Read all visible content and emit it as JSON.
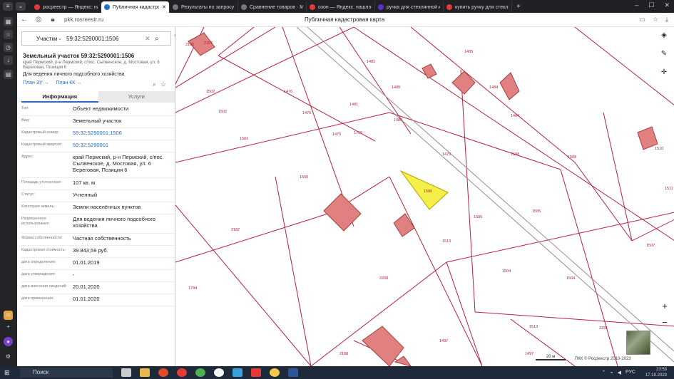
{
  "browser": {
    "tabs": [
      {
        "label": "росреестр — Яндекс: нашл",
        "active": false,
        "color": "#e53935"
      },
      {
        "label": "Публичная кадастровая",
        "active": true,
        "color": "#2a6cc8"
      },
      {
        "label": "Результаты по запросу «р",
        "active": false,
        "color": "#777777"
      },
      {
        "label": "Сравнение товаров · Мар",
        "active": false,
        "color": "#777777"
      },
      {
        "label": "озон — Яндекс: нашлось",
        "active": false,
        "color": "#e53935"
      },
      {
        "label": "ручка для стеклянной кр",
        "active": false,
        "color": "#5b2fd0"
      },
      {
        "label": "купить ручку для стеклян",
        "active": false,
        "color": "#e53935"
      }
    ],
    "new_tab": "+",
    "url": "pkk.rosreestr.ru",
    "page_title": "Публичная кадастровая карта"
  },
  "search": {
    "category": "Участки",
    "value": "59:32:5290001:1506"
  },
  "parcel": {
    "title": "Земельный участок 59:32:5290001:1506",
    "address_short": "край Пермский, р-н Пермский, с/пос. Сылвенское, д. Мостовая, ул. 6 Береговая, Позиция 6",
    "use": "Для ведения личного подсобного хозяйства",
    "plan_zu": "План ЗУ →",
    "plan_kk": "План КК →"
  },
  "tabs": {
    "info": "Информация",
    "services": "Услуги"
  },
  "properties": [
    {
      "label": "Тип:",
      "value": "Объект недвижимости",
      "link": false
    },
    {
      "label": "Вид:",
      "value": "Земельный участок",
      "link": false
    },
    {
      "label": "Кадастровый номер:",
      "value": "59:32:5290001:1506",
      "link": true
    },
    {
      "label": "Кадастровый квартал:",
      "value": "59:32:5290001",
      "link": true
    },
    {
      "label": "Адрес:",
      "value": "край Пермский, р-н Пермский, с/пос. Сылвенское, д. Мостовая, ул. 6 Береговая, Позиция 6",
      "link": false
    },
    {
      "label": "Площадь уточненная:",
      "value": "107 кв. м",
      "link": false
    },
    {
      "label": "Статус:",
      "value": "Учтенный",
      "link": false
    },
    {
      "label": "Категория земель:",
      "value": "Земли населённых пунктов",
      "link": false
    },
    {
      "label": "Разрешенное использование:",
      "value": "Для ведения личного подсобного хозяйства",
      "link": false
    },
    {
      "label": "Форма собственности:",
      "value": "Частная собственность",
      "link": false
    },
    {
      "label": "Кадастровая стоимость:",
      "value": "39 843,59 руб.",
      "link": false
    },
    {
      "label": "дата определения:",
      "value": "01.01.2019",
      "link": false
    },
    {
      "label": "дата утверждения:",
      "value": "-",
      "link": false
    },
    {
      "label": "дата внесения сведений:",
      "value": "20.01.2020",
      "link": false
    },
    {
      "label": "дата применения:",
      "value": "01.01.2020",
      "link": false
    }
  ],
  "map": {
    "labels": [
      "2196",
      "2197",
      "1485",
      "1481",
      "1480",
      "1484",
      "1502",
      "1476",
      "1481",
      "1502",
      "1476",
      "1480",
      "1484",
      "1501",
      "1475",
      "1750",
      "1479",
      "1508",
      "1508",
      "1510",
      "1500",
      "1506",
      "1505",
      "1505",
      "1512",
      "2187",
      "1513",
      "1507",
      "2208",
      "1504",
      "1504",
      "1794",
      "1513",
      "2231",
      "1497",
      "1497",
      "2188"
    ],
    "scale": "20 м",
    "copyright": "ПКК © Росреестр 2010-2023"
  },
  "taskbar": {
    "search": "Поиск",
    "lang": "РУС",
    "time": "23:53",
    "date": "17.10.2023"
  },
  "colors": {
    "accent": "#2a6cc8",
    "parcel_line": "#b8213a",
    "selected_fill": "#f4f04a",
    "building_fill": "#e08080"
  }
}
